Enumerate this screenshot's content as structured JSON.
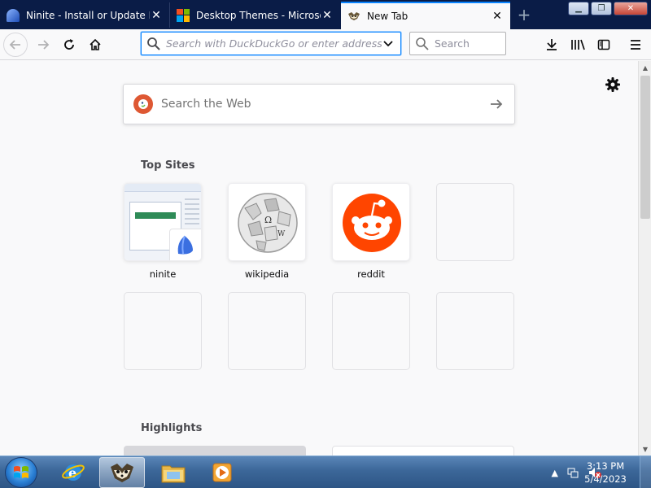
{
  "tabs": [
    {
      "title": "Ninite - Install or Update Mu",
      "favicon": "ninite-icon",
      "active": false
    },
    {
      "title": "Desktop Themes - Microsoft",
      "favicon": "microsoft-logo-icon",
      "active": false
    },
    {
      "title": "New Tab",
      "favicon": "firefox-raccoon-icon",
      "active": true
    }
  ],
  "urlbar": {
    "placeholder": "Search with DuckDuckGo or enter address"
  },
  "searchbar": {
    "placeholder": "Search"
  },
  "newtab": {
    "web_search_placeholder": "Search the Web",
    "top_sites_title": "Top Sites",
    "highlights_title": "Highlights",
    "top_sites": [
      {
        "label": "ninite"
      },
      {
        "label": "wikipedia"
      },
      {
        "label": "reddit"
      }
    ]
  },
  "taskbar": {
    "apps": [
      "internet-explorer-icon",
      "firefox-icon",
      "windows-explorer-icon",
      "media-player-icon"
    ],
    "clock_time": "3:13 PM",
    "clock_date": "5/4/2023"
  },
  "colors": {
    "accent": "#0a84ff",
    "tabstrip": "#0a1c47",
    "reddit": "#ff4500",
    "duckduckgo": "#de5833"
  }
}
